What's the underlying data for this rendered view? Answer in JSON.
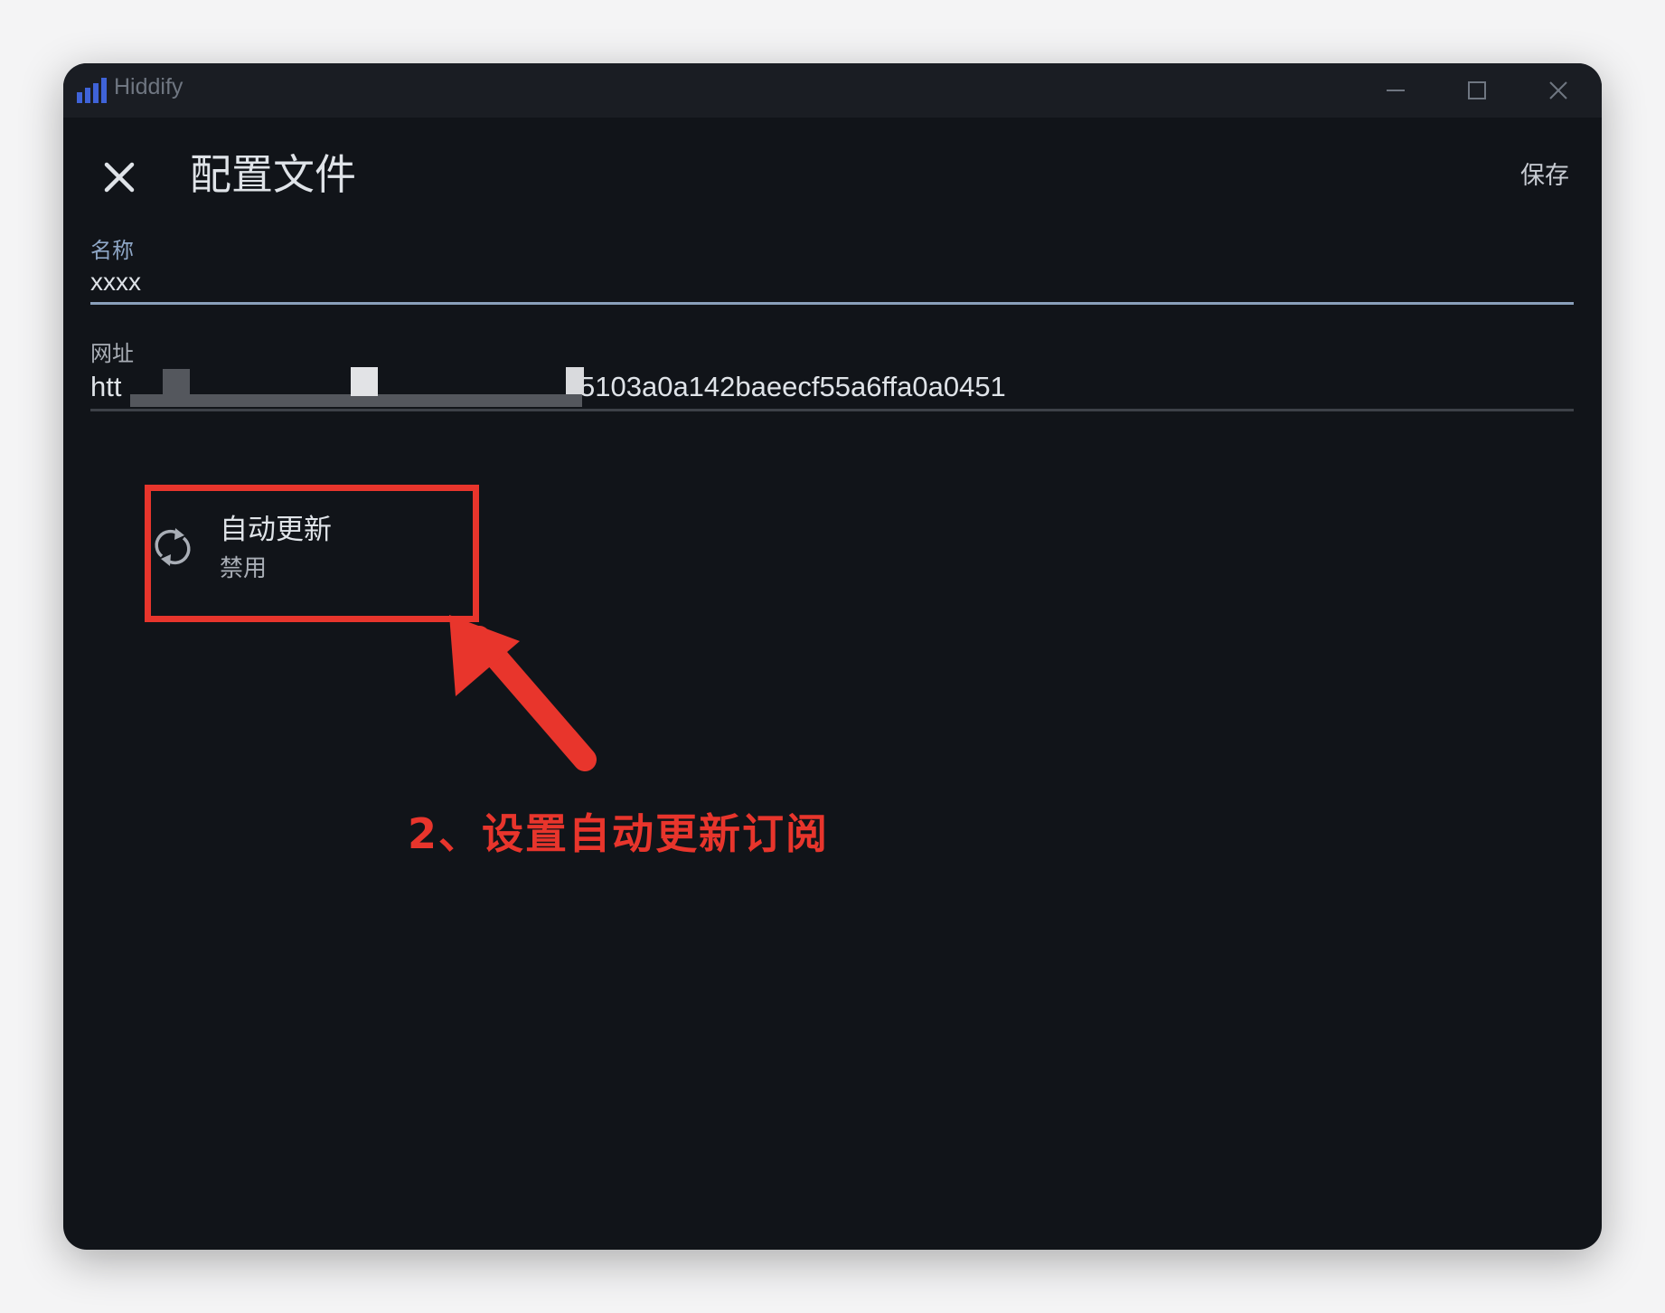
{
  "window": {
    "app_name": "Hiddify",
    "logo_icon": "signal-bars-icon",
    "controls": {
      "minimize_icon": "minimize-icon",
      "maximize_icon": "maximize-icon",
      "close_icon": "close-icon"
    }
  },
  "header": {
    "close_icon": "close-icon",
    "title": "配置文件",
    "save_label": "保存"
  },
  "form": {
    "name": {
      "label": "名称",
      "value": "xxxx"
    },
    "url": {
      "label": "网址",
      "value_start": "htt",
      "value_end": "5103a0a142baeecf55a6ffa0a0451"
    }
  },
  "auto_update": {
    "icon": "sync-icon",
    "title": "自动更新",
    "subtitle": "禁用"
  },
  "annotation": {
    "text": "2、设置自动更新订阅",
    "color": "#e8352c"
  },
  "colors": {
    "background": "#111419",
    "titlebar": "#1a1d23",
    "accent_label": "#8ea6c6",
    "text": "#dfe3e8"
  }
}
